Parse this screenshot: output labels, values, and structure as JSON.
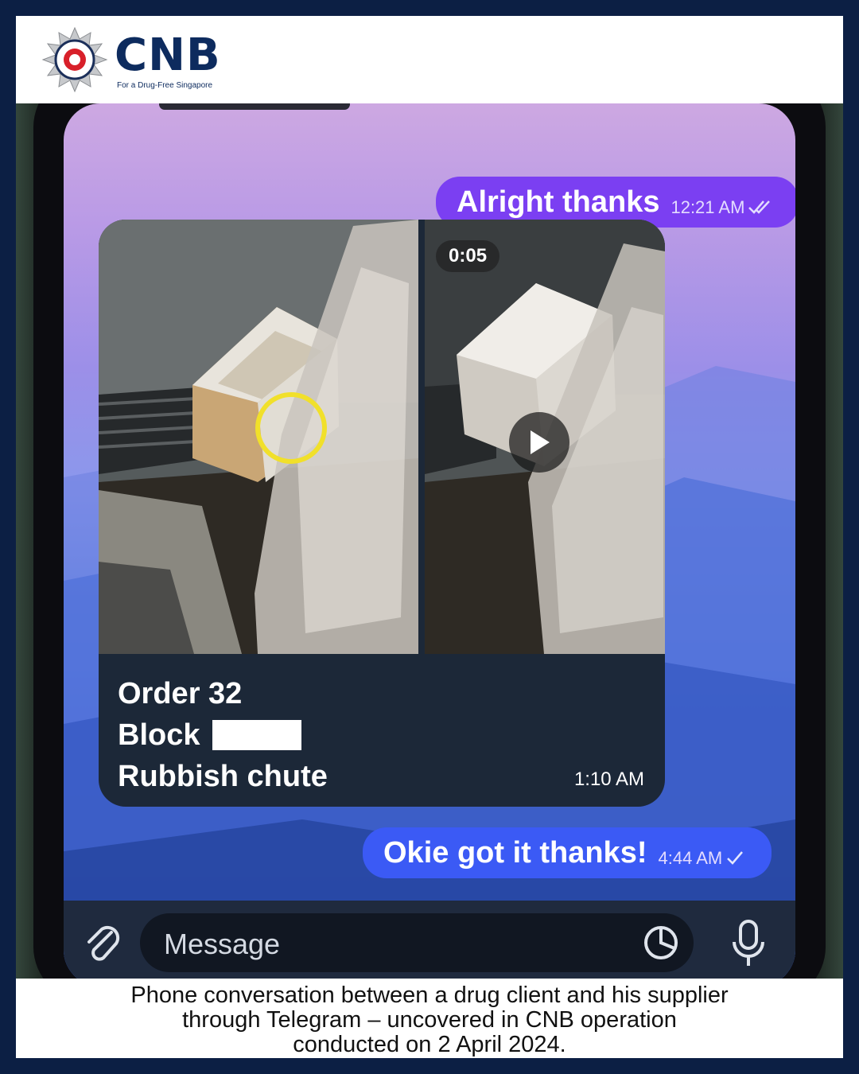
{
  "brand": {
    "logo_text": "CNB",
    "tagline": "For a Drug-Free Singapore",
    "badge_icon": "cnb-crest-icon",
    "navy": "#0c1f44",
    "brand_blue": "#0d2b5e"
  },
  "chat": {
    "messages": [
      {
        "direction": "outgoing",
        "text": "Alright thanks",
        "time": "12:21 AM",
        "status_icon": "double-check-icon",
        "bubble_color": "#7b3ff2"
      },
      {
        "direction": "incoming",
        "type": "media",
        "video_duration": "0:05",
        "caption_lines": [
          "Order 32",
          "Block",
          "Rubbish chute"
        ],
        "time": "1:10 AM"
      },
      {
        "direction": "outgoing",
        "text": "Okie got it thanks!",
        "time": "4:44 AM",
        "status_icon": "check-icon",
        "bubble_color": "#3b5af5"
      }
    ],
    "input": {
      "placeholder": "Message"
    },
    "icons": {
      "attach": "paperclip-icon",
      "sticker": "sticker-icon",
      "voice": "microphone-icon"
    }
  },
  "footer": {
    "caption_lines": [
      "Phone conversation between a drug client and his supplier",
      "through Telegram – uncovered in CNB operation",
      "conducted on 2 April 2024."
    ]
  }
}
